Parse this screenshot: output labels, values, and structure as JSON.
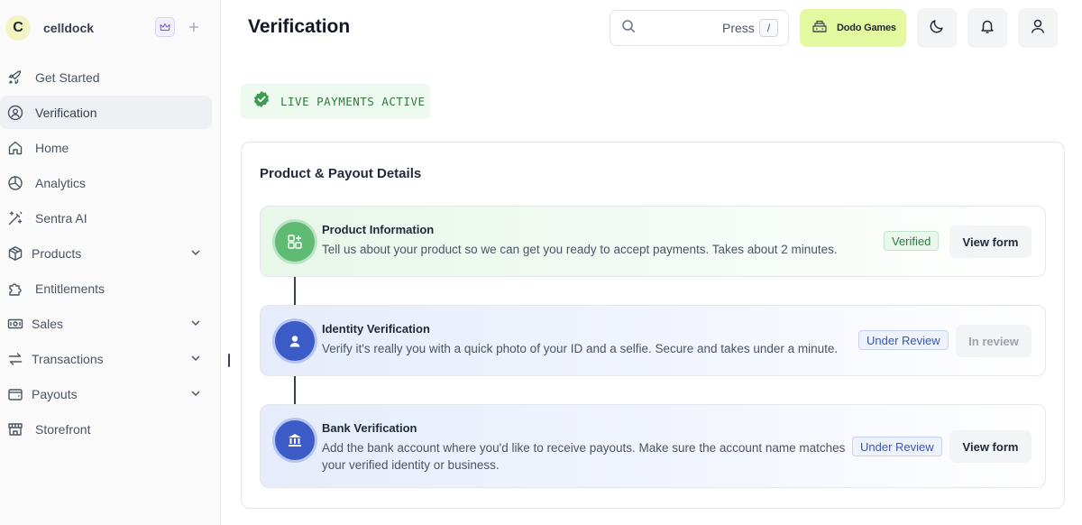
{
  "workspace": {
    "initial": "C",
    "name": "celldock"
  },
  "sidebar": {
    "items": [
      {
        "label": "Get Started",
        "icon": "rocket-icon",
        "active": false,
        "expandable": false
      },
      {
        "label": "Verification",
        "icon": "verification-icon",
        "active": true,
        "expandable": false
      },
      {
        "label": "Home",
        "icon": "home-icon",
        "active": false,
        "expandable": false
      },
      {
        "label": "Analytics",
        "icon": "analytics-icon",
        "active": false,
        "expandable": false
      },
      {
        "label": "Sentra AI",
        "icon": "sparkle-wand-icon",
        "active": false,
        "expandable": false
      },
      {
        "label": "Products",
        "icon": "package-icon",
        "active": false,
        "expandable": true
      },
      {
        "label": "Entitlements",
        "icon": "puzzle-icon",
        "active": false,
        "expandable": false
      },
      {
        "label": "Sales",
        "icon": "cash-icon",
        "active": false,
        "expandable": true
      },
      {
        "label": "Transactions",
        "icon": "transfer-icon",
        "active": false,
        "expandable": true
      },
      {
        "label": "Payouts",
        "icon": "wallet-icon",
        "active": false,
        "expandable": true
      },
      {
        "label": "Storefront",
        "icon": "store-icon",
        "active": false,
        "expandable": false
      }
    ]
  },
  "header": {
    "title": "Verification",
    "search": {
      "placeholder": "",
      "press_label": "Press",
      "shortcut": "/"
    },
    "brand_button": "Dodo Games"
  },
  "status": {
    "live_label": "LIVE PAYMENTS ACTIVE"
  },
  "card": {
    "title": "Product & Payout Details",
    "steps": [
      {
        "title": "Product Information",
        "description": "Tell us about your product so we can get you ready to accept payments. Takes about 2 minutes.",
        "badge": "Verified",
        "button": "View form"
      },
      {
        "title": "Identity Verification",
        "description": "Verify it's really you with a quick photo of your ID and a selfie. Secure and takes under a minute.",
        "badge": "Under Review",
        "button": "In review"
      },
      {
        "title": "Bank Verification",
        "description": "Add the bank account where you'd like to receive payouts. Make sure the account name matches your verified identity or business.",
        "badge": "Under Review",
        "button": "View form"
      }
    ]
  },
  "colors": {
    "accent": "#e4f8a0",
    "verified": "#2f7a3d",
    "review": "#3558b8",
    "step_icon_green": "#5fba73",
    "step_icon_blue": "#3b5bc6"
  }
}
